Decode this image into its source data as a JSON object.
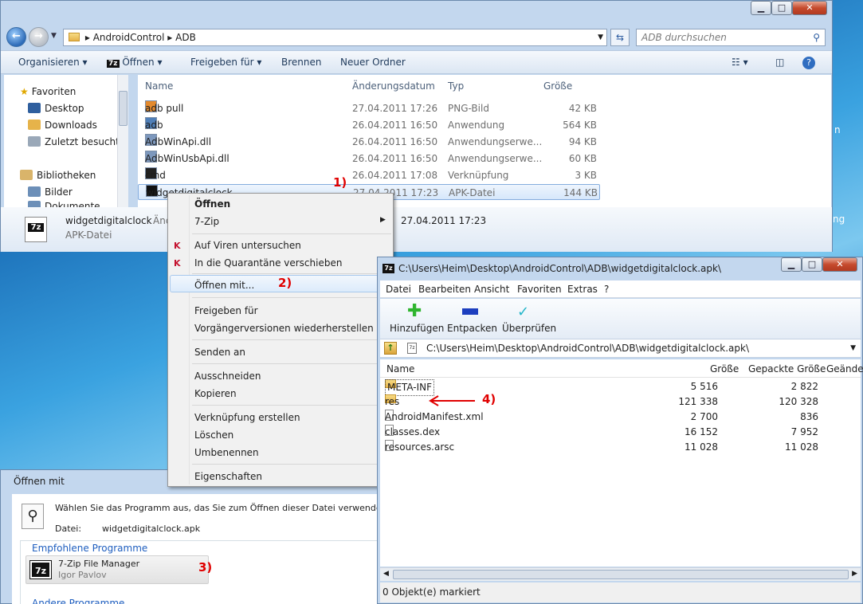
{
  "explorer": {
    "breadcrumb": [
      "AndroidControl",
      "ADB"
    ],
    "search_placeholder": "ADB durchsuchen",
    "toolbar": {
      "organize": "Organisieren",
      "open": "Öffnen",
      "share": "Freigeben für",
      "burn": "Brennen",
      "new_folder": "Neuer Ordner"
    },
    "nav": {
      "favorites": "Favoriten",
      "desktop": "Desktop",
      "downloads": "Downloads",
      "recent": "Zuletzt besucht",
      "libraries": "Bibliotheken",
      "pictures": "Bilder",
      "documents": "Dokumente"
    },
    "columns": {
      "name": "Name",
      "date": "Änderungsdatum",
      "type": "Typ",
      "size": "Größe"
    },
    "files": [
      {
        "name": "adb pull",
        "date": "27.04.2011 17:26",
        "type": "PNG-Bild",
        "size": "42 KB"
      },
      {
        "name": "adb",
        "date": "26.04.2011 16:50",
        "type": "Anwendung",
        "size": "564 KB"
      },
      {
        "name": "AdbWinApi.dll",
        "date": "26.04.2011 16:50",
        "type": "Anwendungserwe...",
        "size": "94 KB"
      },
      {
        "name": "AdbWinUsbApi.dll",
        "date": "26.04.2011 16:50",
        "type": "Anwendungserwe...",
        "size": "60 KB"
      },
      {
        "name": "cmd",
        "date": "26.04.2011 17:08",
        "type": "Verknüpfung",
        "size": "3 KB"
      },
      {
        "name": "widgetdigitalclock",
        "date": "27.04.2011 17:23",
        "type": "APK-Datei",
        "size": "144 KB"
      }
    ],
    "details": {
      "name": "widgetdigitalclock",
      "type": "APK-Datei",
      "date_label_partial": "Änd",
      "date_value": "27.04.2011 17:23",
      "icon_text": "7z"
    }
  },
  "context_menu": {
    "items": [
      "Öffnen",
      "7-Zip",
      "Auf Viren untersuchen",
      "In die Quarantäne verschieben",
      "Öffnen mit...",
      "Freigeben für",
      "Vorgängerversionen wiederherstellen",
      "Senden an",
      "Ausschneiden",
      "Kopieren",
      "Verknüpfung erstellen",
      "Löschen",
      "Umbenennen",
      "Eigenschaften"
    ],
    "kav_icon": "K"
  },
  "open_with": {
    "title": "Öffnen mit",
    "prompt": "Wählen Sie das Programm aus, das Sie zum Öffnen dieser Datei verwenden möchten",
    "file_label": "Datei:",
    "file_value": "widgetdigitalclock.apk",
    "recommended": "Empfohlene Programme",
    "program_name": "7-Zip File Manager",
    "program_author": "Igor Pavlov",
    "other": "Andere Programme",
    "icon_text": "7z"
  },
  "zip": {
    "title": "C:\\Users\\Heim\\Desktop\\AndroidControl\\ADB\\widgetdigitalclock.apk\\",
    "menu": [
      "Datei",
      "Bearbeiten",
      "Ansicht",
      "Favoriten",
      "Extras",
      "?"
    ],
    "tools": {
      "add": "Hinzufügen",
      "extract": "Entpacken",
      "test": "Überprüfen"
    },
    "path": "C:\\Users\\Heim\\Desktop\\AndroidControl\\ADB\\widgetdigitalclock.apk\\",
    "columns": {
      "name": "Name",
      "size": "Größe",
      "packed": "Gepackte Größe",
      "modified": "Geände"
    },
    "rows": [
      {
        "name": "META-INF",
        "size": "5 516",
        "packed": "2 822"
      },
      {
        "name": "res",
        "size": "121 338",
        "packed": "120 328"
      },
      {
        "name": "AndroidManifest.xml",
        "size": "2 700",
        "packed": "836"
      },
      {
        "name": "classes.dex",
        "size": "16 152",
        "packed": "7 952"
      },
      {
        "name": "resources.arsc",
        "size": "11 028",
        "packed": "11 028"
      }
    ],
    "status": "0 Objekt(e) markiert",
    "icon_text": "7z"
  },
  "annotations": [
    "1)",
    "2)",
    "3)",
    "4)"
  ],
  "edge_text": {
    "n": "n",
    "ng": "ng"
  }
}
